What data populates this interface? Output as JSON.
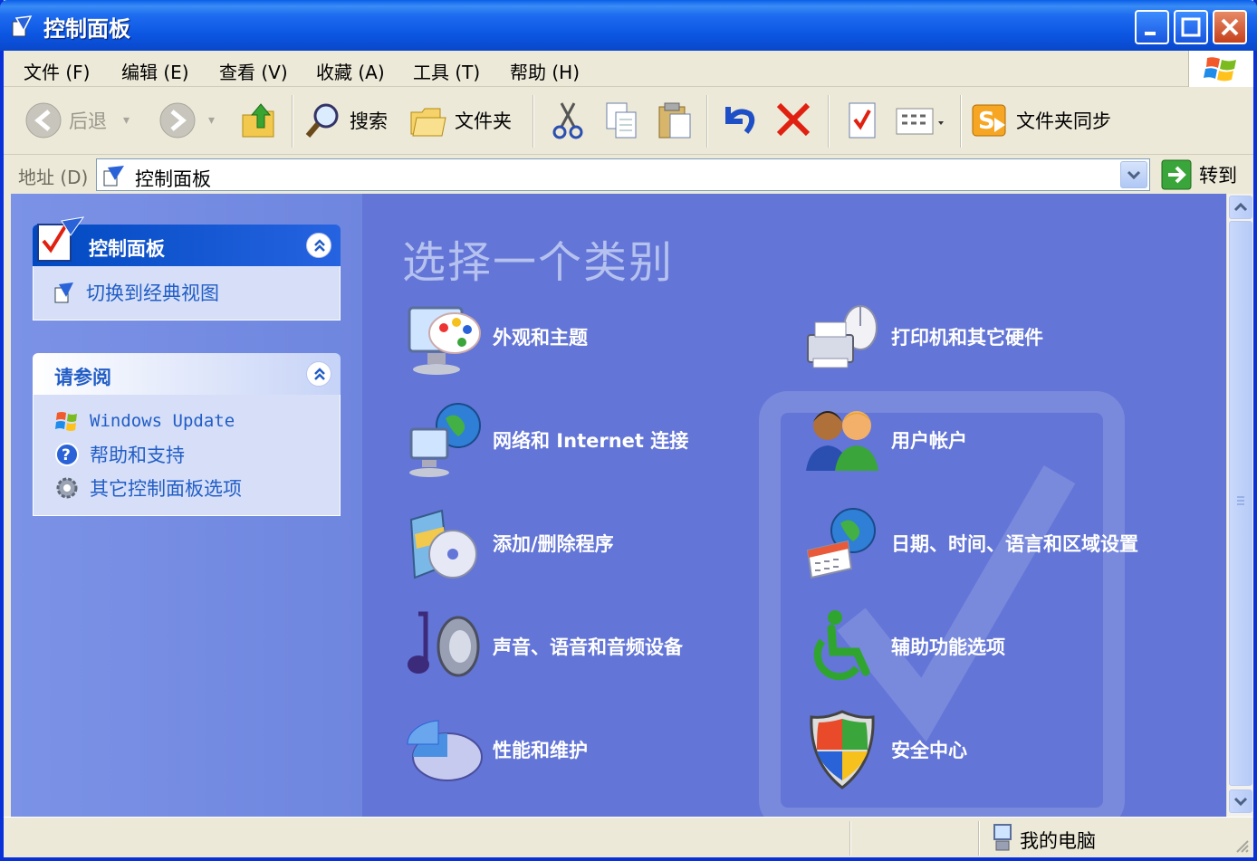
{
  "window": {
    "title": "控制面板"
  },
  "menu": [
    "文件 (F)",
    "编辑 (E)",
    "查看 (V)",
    "收藏 (A)",
    "工具 (T)",
    "帮助 (H)"
  ],
  "toolbar": {
    "back": "后退",
    "search": "搜索",
    "folders": "文件夹",
    "folder_sync": "文件夹同步"
  },
  "address": {
    "label": "地址 (D)",
    "value": "控制面板",
    "go": "转到"
  },
  "left_panel": {
    "control_panel": {
      "title": "控制面板",
      "links": [
        "切换到经典视图"
      ]
    },
    "see_also": {
      "title": "请参阅",
      "links": [
        "Windows Update",
        "帮助和支持",
        "其它控制面板选项"
      ]
    }
  },
  "main": {
    "heading": "选择一个类别",
    "categories": [
      "外观和主题",
      "打印机和其它硬件",
      "网络和 Internet 连接",
      "用户帐户",
      "添加/删除程序",
      "日期、时间、语言和区域设置",
      "声音、语音和音频设备",
      "辅助功能选项",
      "性能和维护",
      "安全中心"
    ]
  },
  "statusbar": {
    "location": "我的电脑"
  },
  "colors": {
    "title_blue": "#0a5fe9",
    "content_bg": "#6375d6",
    "link_blue": "#215dc6"
  }
}
